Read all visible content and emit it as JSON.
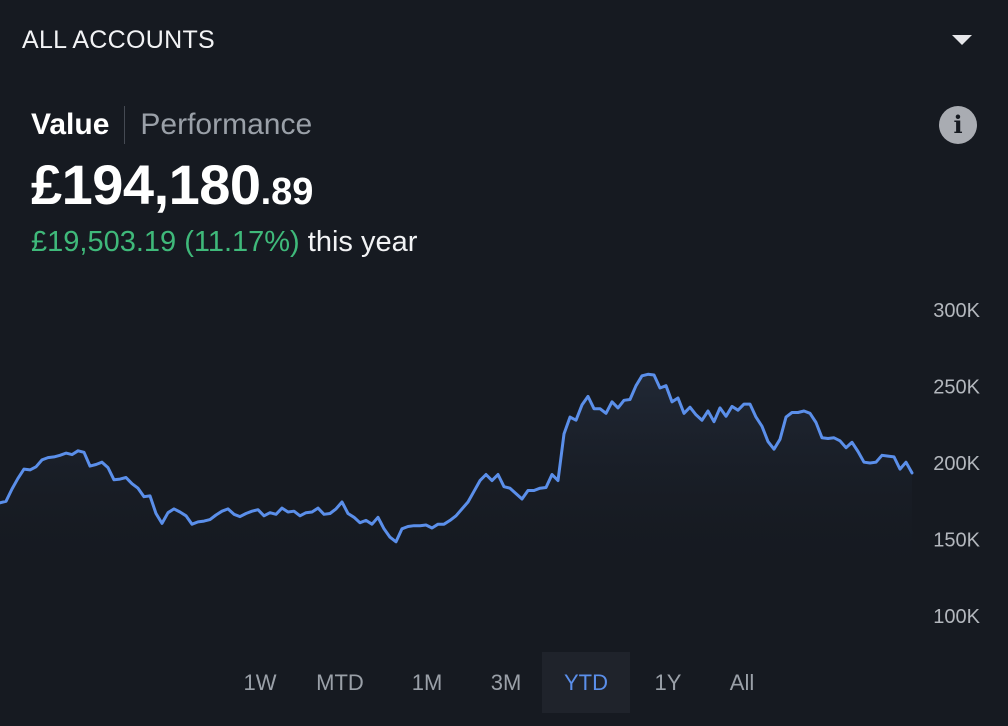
{
  "header": {
    "account_selector": "ALL ACCOUNTS"
  },
  "tabs": [
    {
      "label": "Value",
      "active": true
    },
    {
      "label": "Performance",
      "active": false
    }
  ],
  "info": {
    "icon": "info-icon",
    "glyph": "i"
  },
  "portfolio": {
    "value_main": "£194,180",
    "value_pence": ".89",
    "change_amount": "£19,503.19 (11.17%)",
    "change_suffix": "this year"
  },
  "colors": {
    "background": "#161a21",
    "line": "#5b8fea",
    "positive": "#3fb97a",
    "active_range": "#5b8fea"
  },
  "chart_data": {
    "type": "area",
    "y_ticks": [
      "300K",
      "250K",
      "200K",
      "150K",
      "100K"
    ],
    "ylim": [
      100000,
      300000
    ],
    "grid": false,
    "values": [
      174000,
      175000,
      183000,
      190000,
      196000,
      195500,
      197500,
      202000,
      203500,
      204000,
      205000,
      206500,
      205500,
      208000,
      207000,
      198000,
      199000,
      200500,
      197000,
      189000,
      189500,
      190500,
      186500,
      183500,
      178000,
      178500,
      167000,
      160500,
      167500,
      170000,
      168000,
      165500,
      160000,
      161500,
      162000,
      163000,
      166000,
      168500,
      170000,
      166500,
      165000,
      167000,
      168500,
      169500,
      165500,
      167500,
      166500,
      170500,
      168000,
      168500,
      165500,
      167500,
      168000,
      170500,
      166500,
      167000,
      170000,
      174500,
      167000,
      164500,
      161000,
      162500,
      160000,
      164500,
      157000,
      151500,
      148500,
      157000,
      158500,
      159000,
      159000,
      159500,
      157500,
      160000,
      160000,
      162500,
      165500,
      170000,
      174500,
      181500,
      188500,
      192500,
      188500,
      192500,
      184500,
      183500,
      180000,
      176500,
      182000,
      182000,
      183500,
      184000,
      192500,
      188500,
      219000,
      230000,
      228000,
      238000,
      243500,
      235500,
      235500,
      232500,
      240000,
      236000,
      241000,
      241500,
      250500,
      257000,
      258000,
      257500,
      249000,
      250500,
      240000,
      242500,
      232500,
      236500,
      231500,
      228000,
      234000,
      227000,
      236000,
      230500,
      237000,
      234500,
      238500,
      238500,
      230000,
      224000,
      214000,
      209000,
      215500,
      230000,
      233000,
      233000,
      234000,
      232500,
      226500,
      216500,
      216000,
      216500,
      214500,
      210000,
      213500,
      207500,
      200500,
      200000,
      200500,
      205000,
      204500,
      204000,
      196000,
      200500,
      193500
    ]
  },
  "ranges": [
    {
      "label": "1W",
      "active": false
    },
    {
      "label": "MTD",
      "active": false
    },
    {
      "label": "1M",
      "active": false
    },
    {
      "label": "3M",
      "active": false
    },
    {
      "label": "YTD",
      "active": true
    },
    {
      "label": "1Y",
      "active": false
    },
    {
      "label": "All",
      "active": false
    }
  ]
}
